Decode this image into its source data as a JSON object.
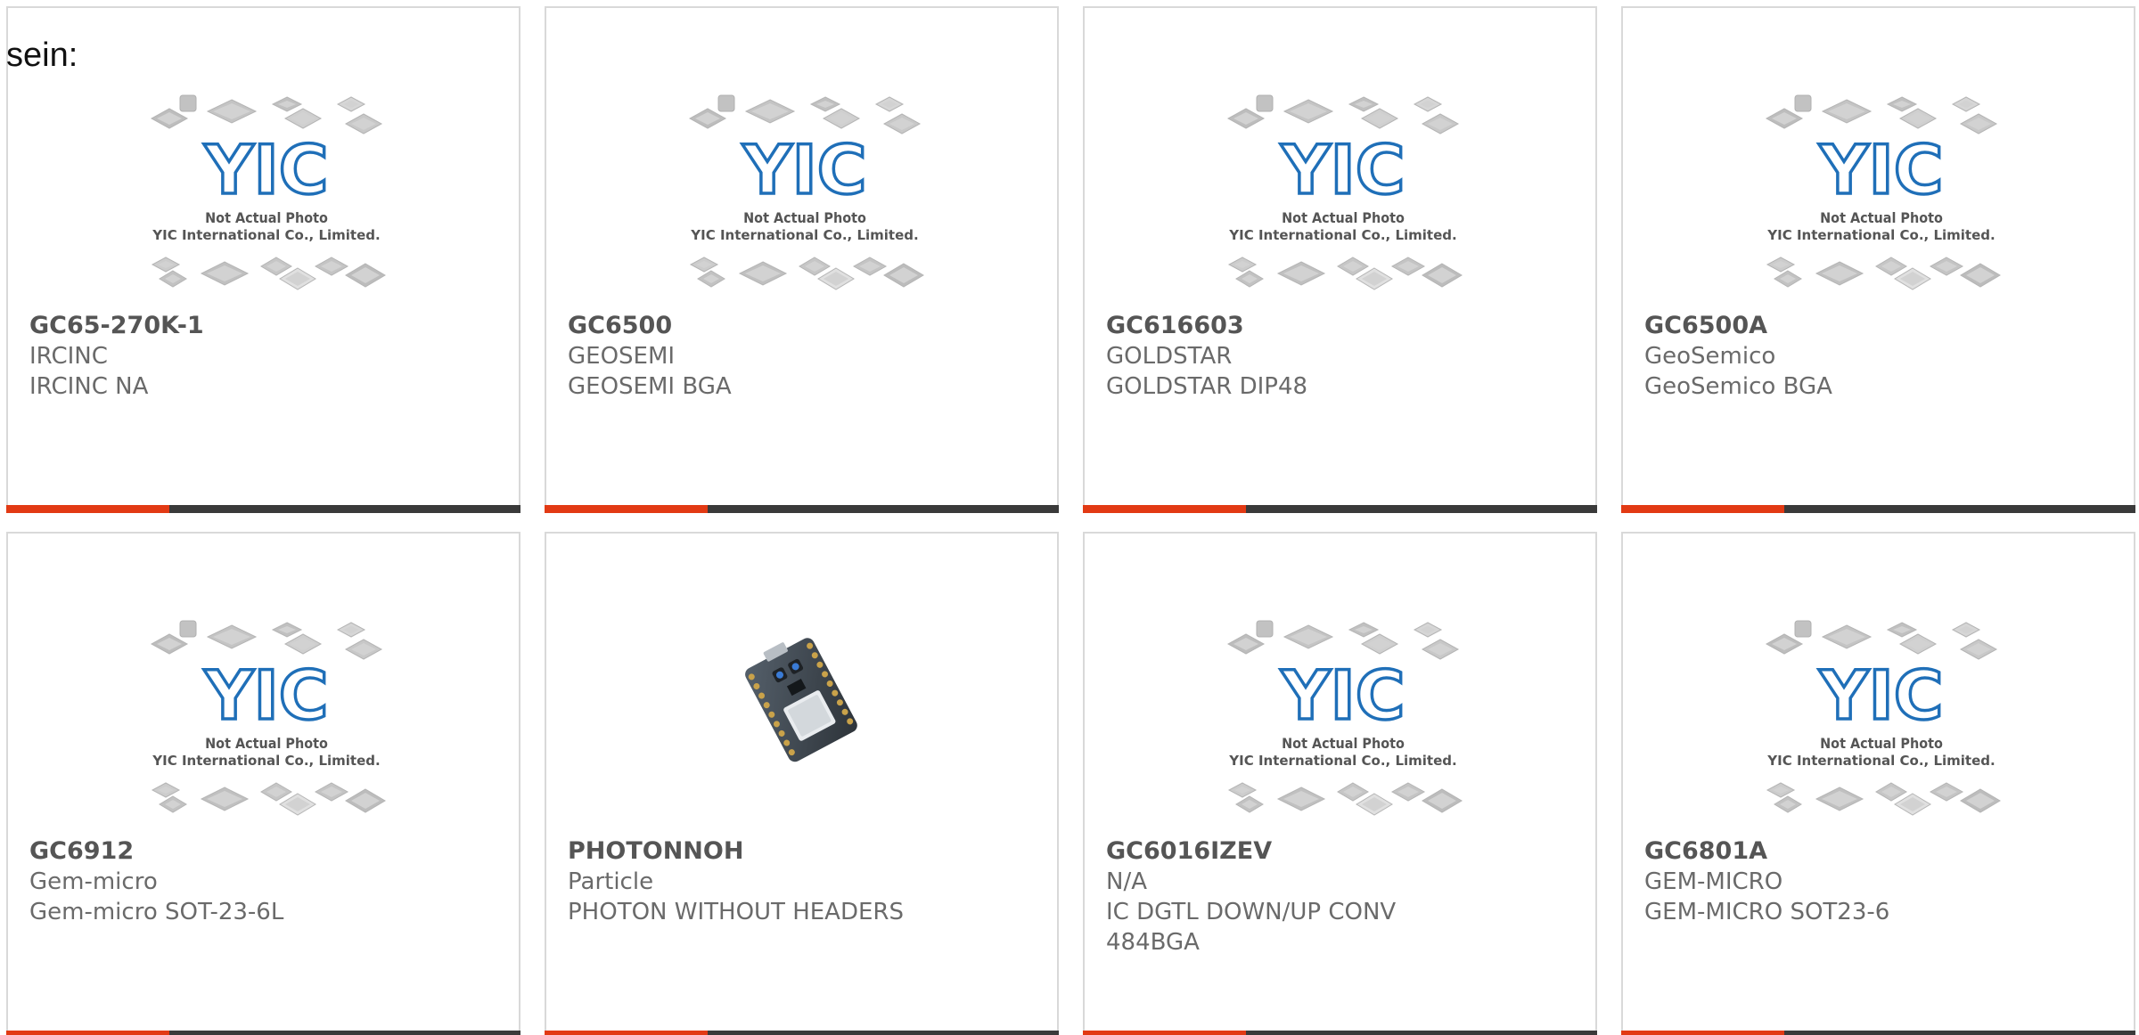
{
  "intro": {
    "text": "sein:"
  },
  "placeholder": {
    "caption_line1": "Not Actual Photo",
    "caption_line2": "YIC International Co., Limited.",
    "logo_text": "YIC"
  },
  "colors": {
    "accent": "#e23a14",
    "bar": "#3a3a3a",
    "border": "#d9d9d9",
    "logo_blue": "#1f6fb8",
    "text": "#6a6a6a"
  },
  "products": [
    {
      "part": "GC65-270K-1",
      "maker": "IRCINC",
      "desc": "IRCINC NA",
      "image": "placeholder"
    },
    {
      "part": "GC6500",
      "maker": "GEOSEMI",
      "desc": "GEOSEMI BGA",
      "image": "placeholder"
    },
    {
      "part": "GC616603",
      "maker": "GOLDSTAR",
      "desc": "GOLDSTAR DIP48",
      "image": "placeholder"
    },
    {
      "part": "GC6500A",
      "maker": "GeoSemico",
      "desc": "GeoSemico BGA",
      "image": "placeholder"
    },
    {
      "part": "GC6912",
      "maker": "Gem-micro",
      "desc": "Gem-micro SOT-23-6L",
      "image": "placeholder"
    },
    {
      "part": "PHOTONNOH",
      "maker": "Particle",
      "desc": "PHOTON WITHOUT HEADERS",
      "image": "photon-board"
    },
    {
      "part": "GC6016IZEV",
      "maker": "N/A",
      "desc": "IC DGTL DOWN/UP CONV 484BGA",
      "image": "placeholder"
    },
    {
      "part": "GC6801A",
      "maker": "GEM-MICRO",
      "desc": "GEM-MICRO SOT23-6",
      "image": "placeholder"
    }
  ]
}
